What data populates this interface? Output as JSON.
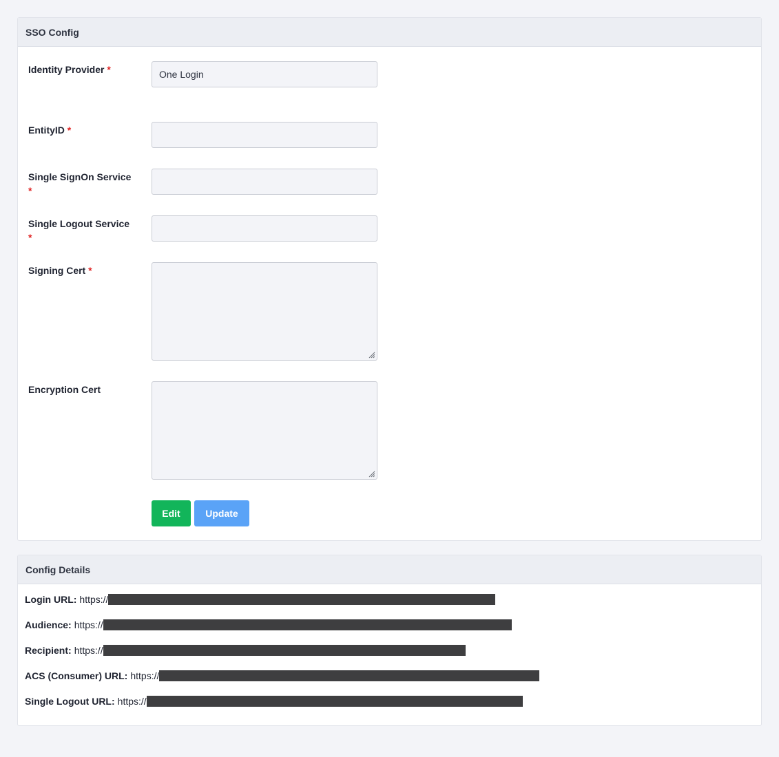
{
  "sso_config": {
    "title": "SSO Config",
    "fields": {
      "identity_provider": {
        "label": "Identity Provider",
        "required_mark": "*",
        "value": "One Login"
      },
      "entity_id": {
        "label": "EntityID",
        "required_mark": "*",
        "value": ""
      },
      "single_signon": {
        "label": "Single SignOn Service",
        "required_mark": "*",
        "value": ""
      },
      "single_logout": {
        "label": "Single Logout Service",
        "required_mark": "*",
        "value": ""
      },
      "signing_cert": {
        "label": "Signing Cert",
        "required_mark": "*",
        "value": ""
      },
      "encryption_cert": {
        "label": "Encryption Cert",
        "value": ""
      }
    },
    "edit_label": "Edit",
    "update_label": "Update"
  },
  "config_details": {
    "title": "Config Details",
    "rows": [
      {
        "label": "Login URL:",
        "value": "https://"
      },
      {
        "label": "Audience:",
        "value": "https://"
      },
      {
        "label": "Recipient:",
        "value": "https://"
      },
      {
        "label": "ACS (Consumer) URL:",
        "value": "https://"
      },
      {
        "label": "Single Logout URL:",
        "value": "https://"
      }
    ]
  },
  "colors": {
    "edit_button": "#12b55a",
    "update_button": "#5aa3f7",
    "required": "#e02424",
    "redaction": "#3e3e40"
  }
}
